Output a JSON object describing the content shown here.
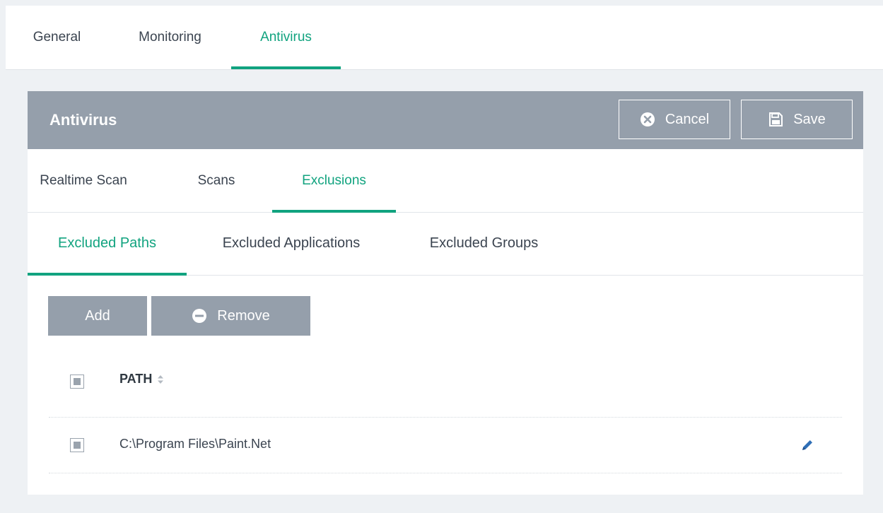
{
  "top_tabs": [
    "General",
    "Monitoring",
    "Antivirus"
  ],
  "panel": {
    "title": "Antivirus",
    "cancel_label": "Cancel",
    "save_label": "Save"
  },
  "scan_tabs": [
    "Realtime Scan",
    "Scans",
    "Exclusions"
  ],
  "exclusion_tabs": [
    "Excluded Paths",
    "Excluded Applications",
    "Excluded Groups"
  ],
  "actions": {
    "add_label": "Add",
    "remove_label": "Remove"
  },
  "table": {
    "columns": [
      "PATH"
    ],
    "rows": [
      {
        "path": "C:\\Program Files\\Paint.Net"
      }
    ]
  },
  "icons": {
    "cancel": "close-circle-icon",
    "save": "floppy-disk-icon",
    "remove": "minus-circle-icon",
    "sort": "sort-arrows-icon",
    "edit": "pencil-icon"
  },
  "colors": {
    "accent": "#11a37f",
    "header_bg": "#959fab",
    "button_bg": "#959fab",
    "page_bg": "#eef1f4",
    "edit_icon": "#2f6fb6"
  }
}
